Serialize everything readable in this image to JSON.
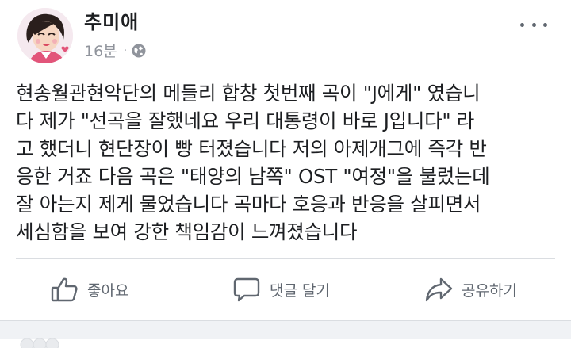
{
  "post": {
    "author": "추미애",
    "time": "16분",
    "separator": "·",
    "privacy_icon": "globe-icon",
    "text_lines": [
      "현송월관현악단의 메들리 합창 첫번째 곡이 \"J에게\" 였습니",
      "다  제가 \"선곡을 잘했네요 우리 대통령이 바로 J입니다\" 라",
      "고 했더니 현단장이 빵 터졌습니다 저의 아제개그에 즉각 반",
      "응한 거죠  다음 곡은 \"태양의 남쪽\" OST \"여정\"을 불렀는데",
      "잘 아는지 제게  물었습니다 곡마다 호응과 반응을 살피면서",
      "세심함을 보여 강한 책임감이 느껴졌습니다"
    ]
  },
  "actions": {
    "like_label": "좋아요",
    "comment_label": "댓글 달기",
    "share_label": "공유하기"
  },
  "colors": {
    "text": "#1c1e21",
    "secondary": "#606770",
    "meta": "#90949c",
    "divider": "#dadde1"
  }
}
